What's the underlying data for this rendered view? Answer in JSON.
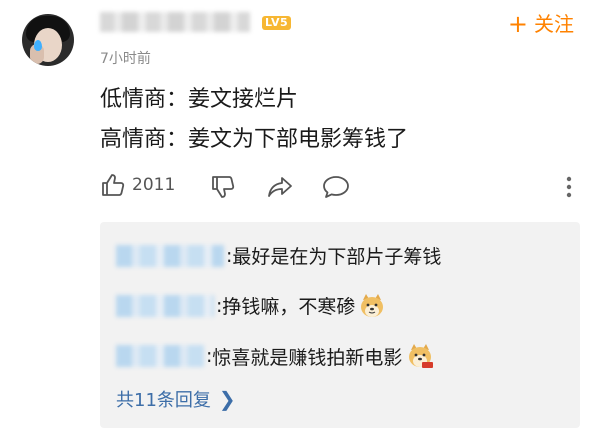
{
  "header": {
    "level_badge": "LV5",
    "follow_label": "关注",
    "time": "7小时前"
  },
  "comment": {
    "lines": [
      "低情商：姜文接烂片",
      "高情商：姜文为下部电影筹钱了"
    ],
    "like_count": "2011"
  },
  "replies": {
    "items": [
      {
        "text": "最好是在为下部片子筹钱",
        "emoji": ""
      },
      {
        "text": "挣钱嘛，不寒碜",
        "emoji": "doge-icon"
      },
      {
        "text": "惊喜就是赚钱拍新电影",
        "emoji": "doge-money-icon"
      }
    ],
    "more_label": "共11条回复"
  },
  "colors": {
    "accent": "#ff8200",
    "link": "#3d6ea8",
    "badge": "#f7b733"
  }
}
